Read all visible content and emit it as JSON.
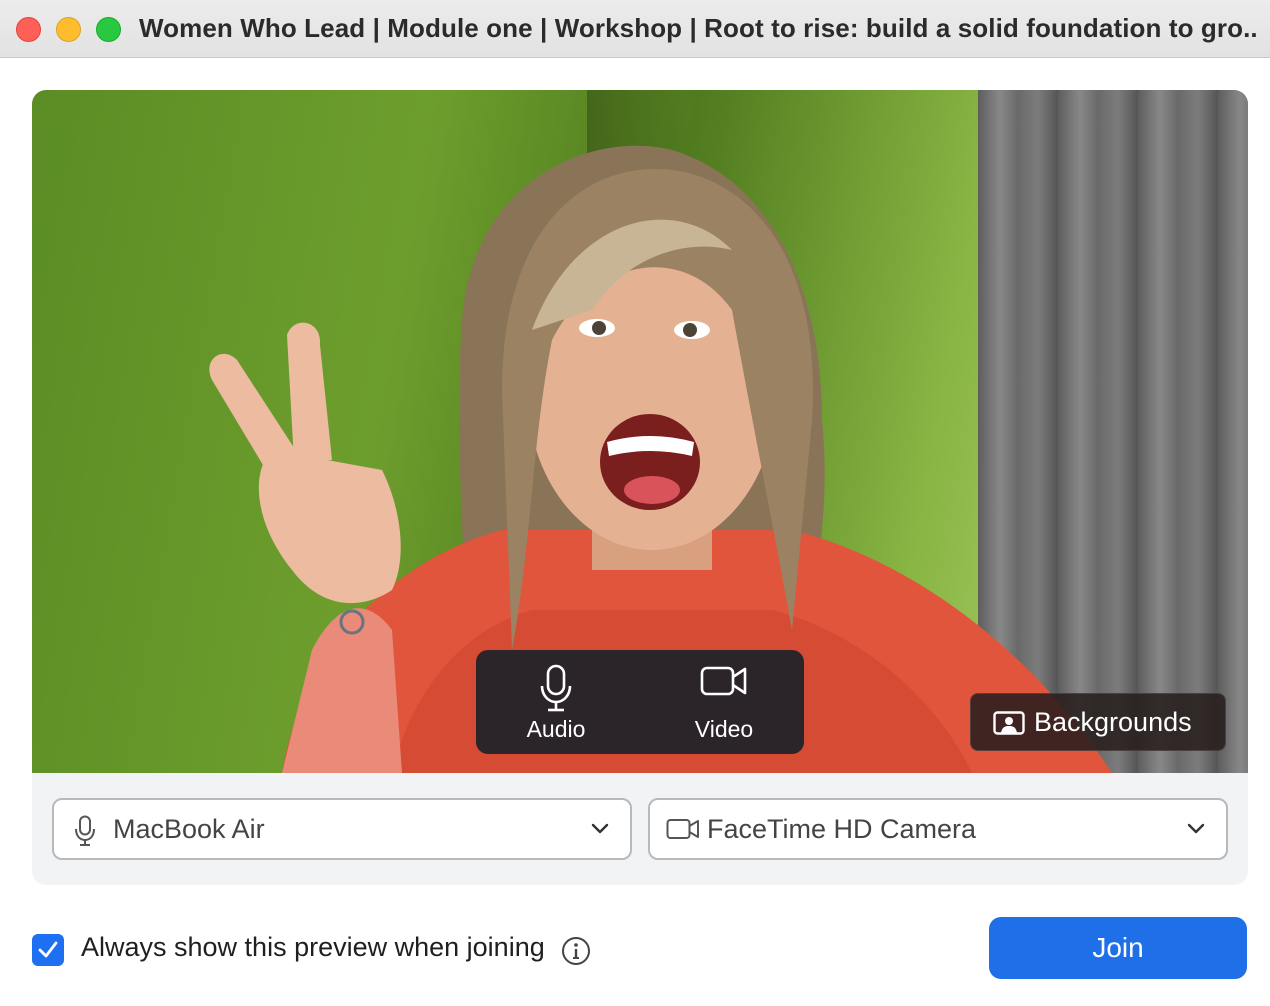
{
  "window": {
    "title": "Women Who Lead | Module one | Workshop | Root to rise: build a solid foundation to gro..."
  },
  "preview": {
    "audio_label": "Audio",
    "video_label": "Video",
    "backgrounds_label": "Backgrounds"
  },
  "devices": {
    "microphone": "MacBook Air",
    "camera": "FaceTime HD Camera"
  },
  "footer": {
    "always_show_label": "Always show this preview when joining",
    "always_show_checked": true,
    "join_label": "Join"
  },
  "colors": {
    "accent": "#1f6fe8",
    "checkbox": "#1f6ff2",
    "close": "#fe5f57",
    "minimize": "#febc2e",
    "maximize": "#28c840"
  },
  "icons": [
    "microphone-icon",
    "video-camera-icon",
    "person-background-icon",
    "chevron-down-icon",
    "checkmark-icon",
    "info-icon"
  ]
}
